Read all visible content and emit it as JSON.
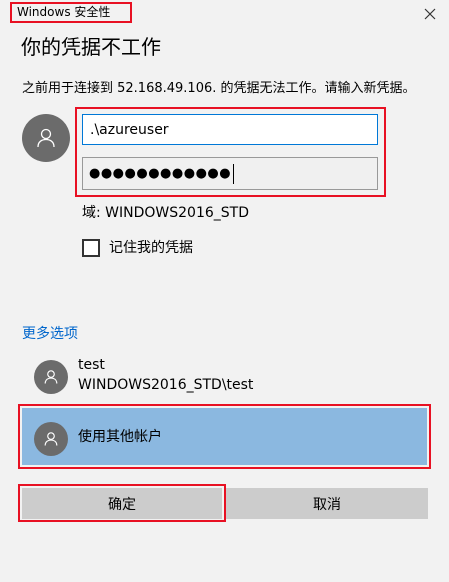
{
  "window": {
    "title": "Windows 安全性"
  },
  "dialog": {
    "heading": "你的凭据不工作",
    "message": "之前用于连接到 52.168.49.106. 的凭据无法工作。请输入新凭据。",
    "username_value": ".\\azureuser",
    "password_mask": "●●●●●●●●●●●●",
    "domain_label": "域: WINDOWS2016_STD",
    "remember_label": "记住我的凭据",
    "remember_checked": false,
    "more_options_label": "更多选项"
  },
  "accounts": [
    {
      "name": "test",
      "sub": "WINDOWS2016_STD\\test"
    }
  ],
  "other_account_label": "使用其他帐户",
  "buttons": {
    "ok": "确定",
    "cancel": "取消"
  },
  "colors": {
    "highlight": "#e81123",
    "link": "#0066cc",
    "selected_row": "#8bb8e0",
    "focus_border": "#0078d7",
    "avatar": "#6b6b6b"
  },
  "icons": {
    "close": "close-icon",
    "avatar": "user-icon",
    "checkbox": "checkbox-icon"
  }
}
